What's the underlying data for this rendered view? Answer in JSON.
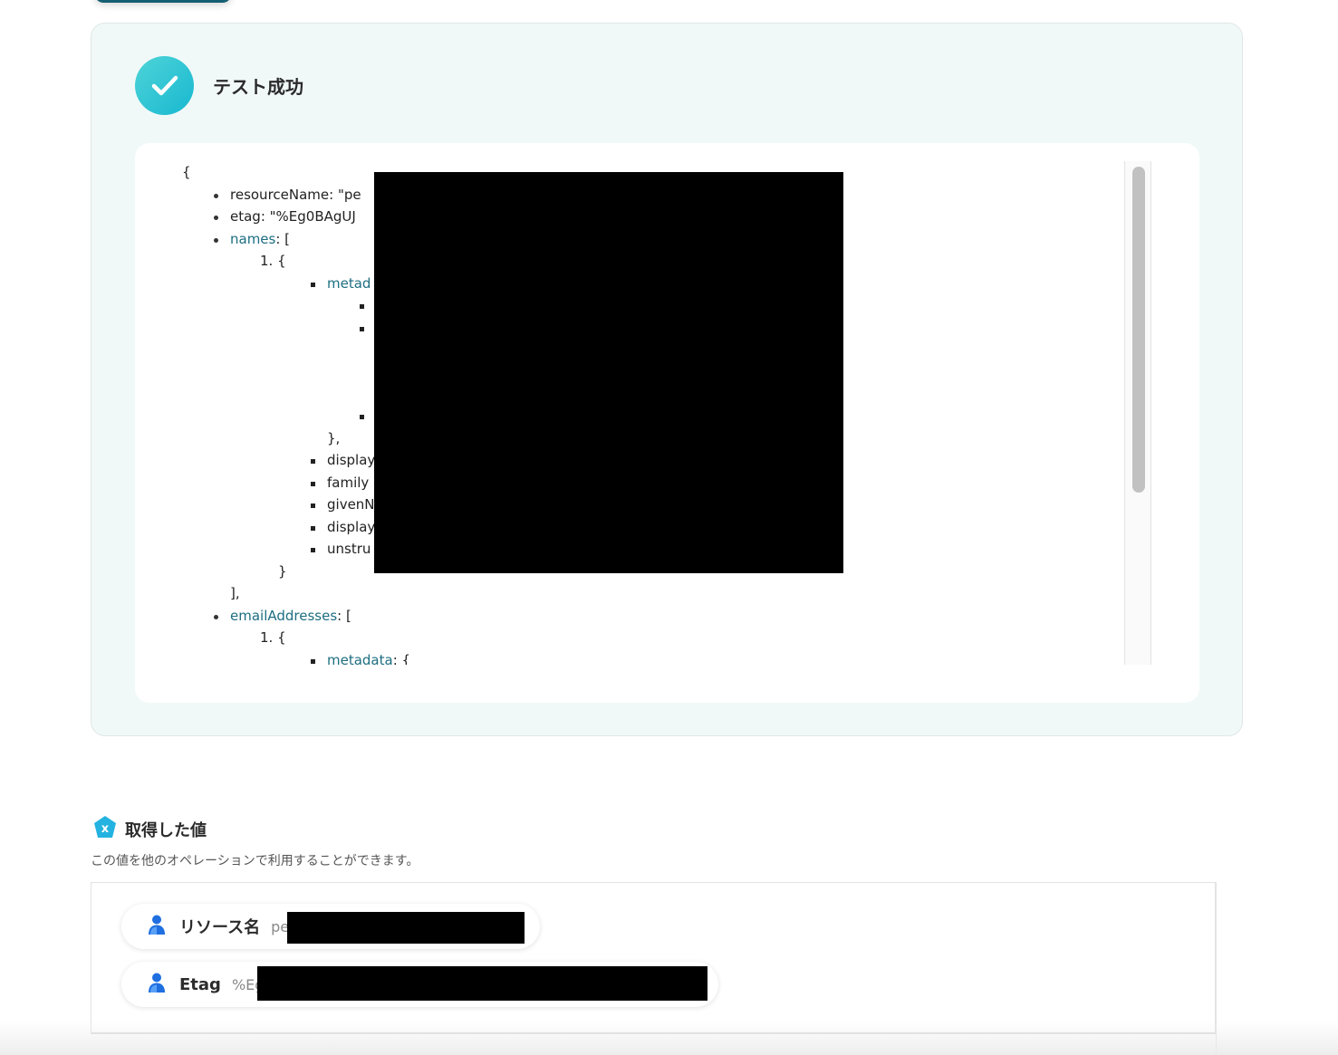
{
  "status": {
    "title": "テスト成功",
    "icon": "check-icon",
    "accent": "#22c3d3"
  },
  "json_view": {
    "open_brace": "{",
    "lines": {
      "resource_name": "resourceName: \"pe",
      "etag": "etag: \"%Eg0BAgUJ",
      "names_key": "names",
      "names_open": ": [",
      "item1": "1. {",
      "metadata_partial": "metad",
      "close_obj_comma": "},",
      "display1": "display",
      "family": "family",
      "given": "givenN",
      "display2": "display",
      "unstru": "unstru",
      "close_brace": "}",
      "close_arr": "],",
      "email_key": "emailAddresses",
      "email_open": ": [",
      "item1b": "1. {",
      "metadata_key": "metadata",
      "metadata_open": ": {"
    }
  },
  "values_section": {
    "title": "取得した値",
    "icon": "variable-x-icon",
    "description": "この値を他のオペレーションで利用することができます。",
    "items": [
      {
        "label": "リソース名",
        "value_prefix": "pe",
        "icon": "person-icon"
      },
      {
        "label": "Etag",
        "value_prefix": "%Eg",
        "icon": "person-icon"
      }
    ]
  }
}
